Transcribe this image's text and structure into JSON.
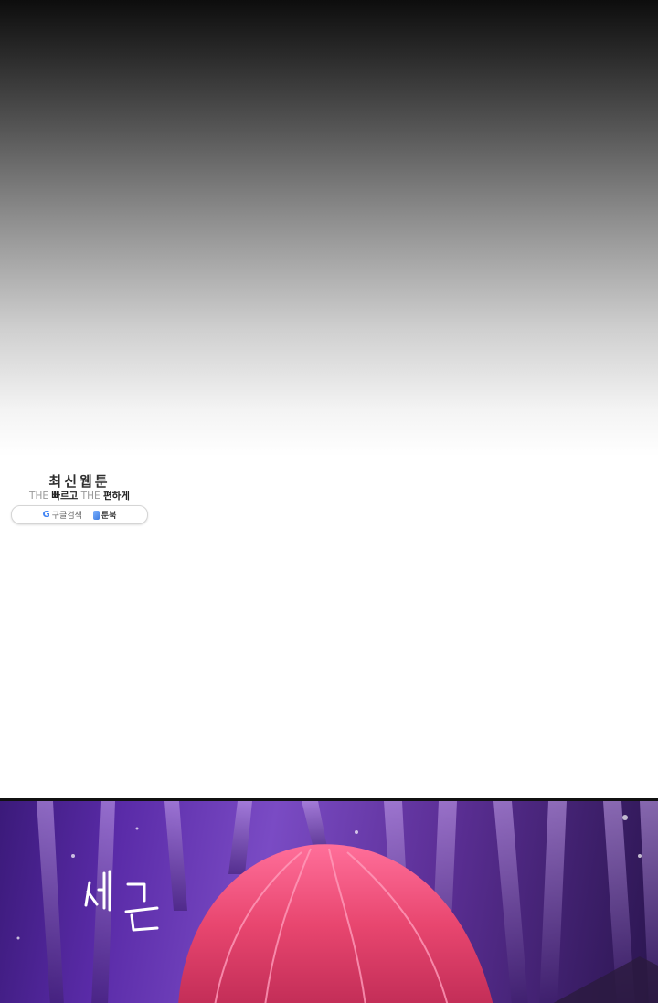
{
  "watermark": {
    "title": "최신웹툰",
    "tagline": {
      "the1": "THE",
      "fast": "빠르고",
      "the2": "THE",
      "easy": "편하게"
    },
    "search_pill": {
      "google_icon": "google-g-icon",
      "google_label": "구글검색",
      "app_icon": "book-icon",
      "app_label": "툰북"
    }
  },
  "panel": {
    "sound_effect": "새근"
  }
}
